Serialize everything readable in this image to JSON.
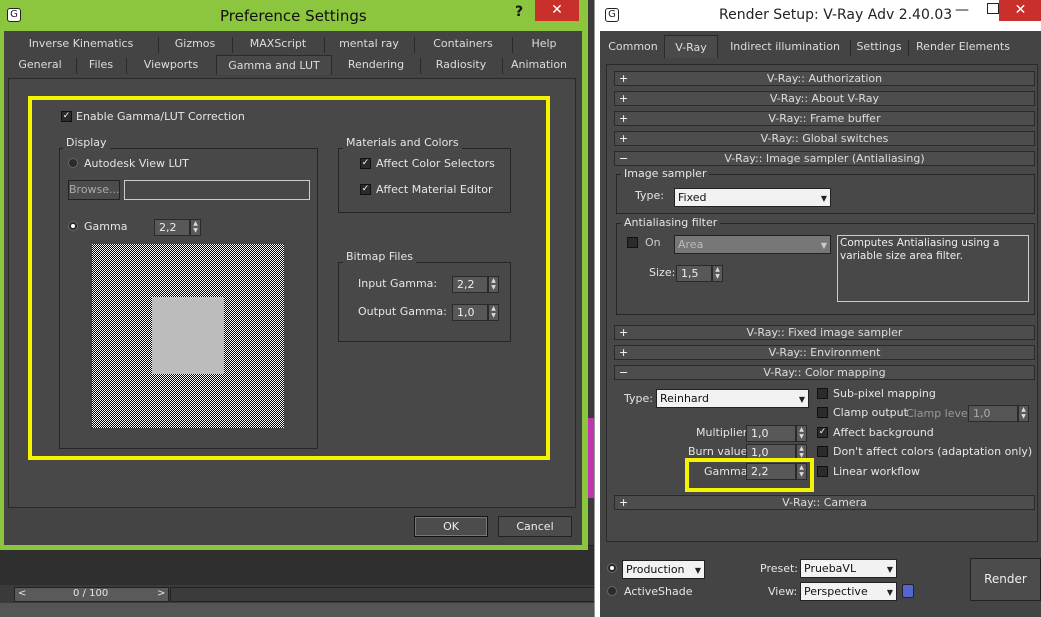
{
  "pref": {
    "title": "Preference Settings",
    "help_label": "?",
    "tabs_row1": [
      "Inverse Kinematics",
      "Gizmos",
      "MAXScript",
      "mental ray",
      "Containers",
      "Help"
    ],
    "tabs_row2": [
      "General",
      "Files",
      "Viewports",
      "Gamma and LUT",
      "Rendering",
      "Radiosity",
      "Animation"
    ],
    "enable_gamma_label": "Enable Gamma/LUT Correction",
    "display_group": "Display",
    "lut_label": "Autodesk View LUT",
    "browse_label": "Browse...",
    "gamma_label": "Gamma",
    "gamma_value": "2,2",
    "materials_group": "Materials and Colors",
    "affect_color_selectors": "Affect Color Selectors",
    "affect_material_editor": "Affect Material Editor",
    "bitmap_group": "Bitmap Files",
    "input_gamma_label": "Input Gamma:",
    "input_gamma_value": "2,2",
    "output_gamma_label": "Output Gamma:",
    "output_gamma_value": "1,0",
    "ok_label": "OK",
    "cancel_label": "Cancel"
  },
  "timeline": {
    "counter": "0 / 100",
    "prev": "<",
    "next": ">"
  },
  "render": {
    "title": "Render Setup: V-Ray Adv 2.40.03",
    "tabs": [
      "Common",
      "V-Ray",
      "Indirect illumination",
      "Settings",
      "Render Elements"
    ],
    "rollouts_top": [
      "V-Ray:: Authorization",
      "V-Ray:: About V-Ray",
      "V-Ray:: Frame buffer",
      "V-Ray:: Global switches"
    ],
    "image_sampler_rollout": "V-Ray:: Image sampler (Antialiasing)",
    "image_sampler_group": "Image sampler",
    "type_label": "Type:",
    "sampler_type": "Fixed",
    "aa_filter_group": "Antialiasing filter",
    "on_label": "On",
    "filter_type": "Area",
    "filter_desc": "Computes Antialiasing using a variable size area filter.",
    "size_label": "Size:",
    "size_value": "1,5",
    "fixed_sampler_rollout": "V-Ray:: Fixed image sampler",
    "environment_rollout": "V-Ray:: Environment",
    "color_mapping_rollout": "V-Ray:: Color mapping",
    "cm_type_label": "Type:",
    "cm_type": "Reinhard",
    "sub_pixel": "Sub-pixel mapping",
    "clamp_output": "Clamp output",
    "clamp_level_label": "Clamp level:",
    "clamp_level": "1,0",
    "multiplier_label": "Multiplier:",
    "multiplier_value": "1,0",
    "affect_background": "Affect background",
    "burn_label": "Burn value:",
    "burn_value": "1,0",
    "dont_affect": "Don't affect colors (adaptation only)",
    "gamma_label": "Gamma:",
    "gamma_value": "2,2",
    "linear_workflow": "Linear workflow",
    "camera_rollout": "V-Ray:: Camera",
    "production_label": "Production",
    "activeshade_label": "ActiveShade",
    "preset_label": "Preset:",
    "preset_value": "PruebaVL",
    "view_label": "View:",
    "view_value": "Perspective",
    "render_label": "Render"
  },
  "colors": {
    "highlight": "#f4f400",
    "frame_green": "#8cc63f",
    "close_red": "#c9302c"
  }
}
